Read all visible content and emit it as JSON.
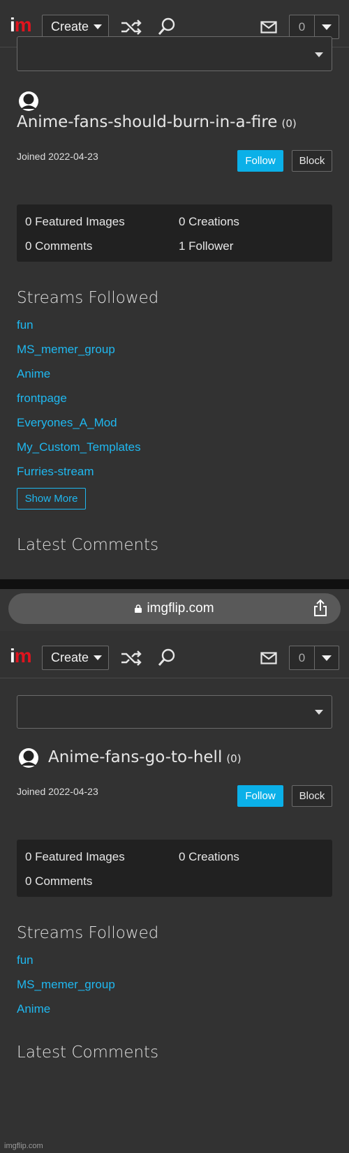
{
  "header": {
    "logo_i": "i",
    "logo_m": "m",
    "create_label": "Create",
    "notification_count": "0",
    "icons": [
      "shuffle-icon",
      "search-icon",
      "mail-icon"
    ]
  },
  "browser": {
    "url": "imgflip.com"
  },
  "profiles": [
    {
      "username": "Anime-fans-should-burn-in-a-fire",
      "points": "(0)",
      "joined": "Joined 2022-04-23",
      "follow_label": "Follow",
      "block_label": "Block",
      "stats": {
        "featured": "0 Featured Images",
        "creations": "0 Creations",
        "comments": "0 Comments",
        "followers": "1 Follower"
      },
      "streams_title": "Streams Followed",
      "streams": [
        "fun",
        "MS_memer_group",
        "Anime",
        "frontpage",
        "Everyones_A_Mod",
        "My_Custom_Templates",
        "Furries-stream"
      ],
      "show_more_label": "Show More",
      "latest_comments_title": "Latest Comments"
    },
    {
      "username": "Anime-fans-go-to-hell",
      "points": "(0)",
      "joined": "Joined 2022-04-23",
      "follow_label": "Follow",
      "block_label": "Block",
      "stats": {
        "featured": "0 Featured Images",
        "creations": "0 Creations",
        "comments": "0 Comments"
      },
      "streams_title": "Streams Followed",
      "streams": [
        "fun",
        "MS_memer_group",
        "Anime"
      ],
      "latest_comments_title": "Latest Comments"
    }
  ],
  "watermark": "imgflip.com",
  "colors": {
    "background": "#323232",
    "link": "#1fb8f0",
    "follow_button": "#0bb0e8",
    "logo_red": "#e0141e"
  }
}
